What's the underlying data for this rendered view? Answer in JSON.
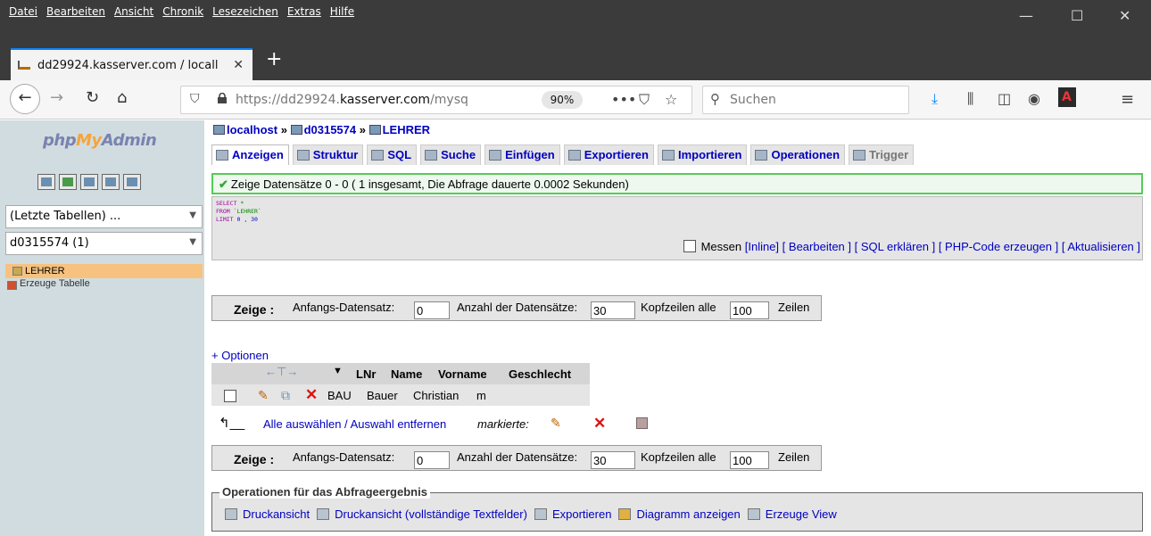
{
  "browser": {
    "menu": [
      "Datei",
      "Bearbeiten",
      "Ansicht",
      "Chronik",
      "Lesezeichen",
      "Extras",
      "Hilfe"
    ],
    "tab_title": "dd29924.kasserver.com / locall",
    "url_host_prefix": "https://dd29924.",
    "url_host_domain": "kasserver.com",
    "url_path": "/mysq",
    "zoom": "90%",
    "search_placeholder": "Suchen"
  },
  "sidebar": {
    "logo_left": "php",
    "logo_mid": "My",
    "logo_right": "Admin",
    "recent_tables": "(Letzte Tabellen) ...",
    "database": "d0315574 (1)",
    "table": "LEHRER",
    "create_table": "Erzeuge Tabelle"
  },
  "breadcrumb": {
    "server": "localhost",
    "database": "d0315574",
    "table": "LEHRER",
    "sep": "»"
  },
  "tabs": [
    "Anzeigen",
    "Struktur",
    "SQL",
    "Suche",
    "Einfügen",
    "Exportieren",
    "Importieren",
    "Operationen",
    "Trigger"
  ],
  "notice": "Zeige Datensätze 0 - 0 ( 1 insgesamt, Die Abfrage dauerte 0.0002 Sekunden)",
  "sql": {
    "select_kw": "SELECT",
    "select_rest": " *",
    "from_kw": "FROM",
    "from_table": " `LEHRER`",
    "limit_kw": "LIMIT",
    "limit_rest": " 0 , 30",
    "measure": "Messen",
    "inline": "[Inline]",
    "edit": "[ Bearbeiten ]",
    "explain": "[ SQL erklären ]",
    "php": "[ PHP-Code erzeugen ]",
    "refresh": "[ Aktualisieren ]"
  },
  "nav": {
    "show_label": "Zeige :",
    "start_label": "Anfangs-Datensatz:",
    "start_value": "0",
    "count_label": "Anzahl der Datensätze:",
    "count_value": "30",
    "header_label": "Kopfzeilen alle",
    "header_value": "100",
    "rows_label": "Zeilen"
  },
  "options_link": "+ Optionen",
  "table": {
    "columns": [
      "LNr",
      "Name",
      "Vorname",
      "Geschlecht"
    ],
    "rows": [
      [
        "BAU",
        "Bauer",
        "Christian",
        "m"
      ]
    ]
  },
  "row_actions": {
    "select_all": "Alle auswählen / Auswahl entfernen",
    "marked": "markierte:"
  },
  "ops": {
    "legend": "Operationen für das Abfrageergebnis",
    "print": "Druckansicht",
    "print_full": "Druckansicht (vollständige Textfelder)",
    "export": "Exportieren",
    "chart": "Diagramm anzeigen",
    "view": "Erzeuge View"
  }
}
